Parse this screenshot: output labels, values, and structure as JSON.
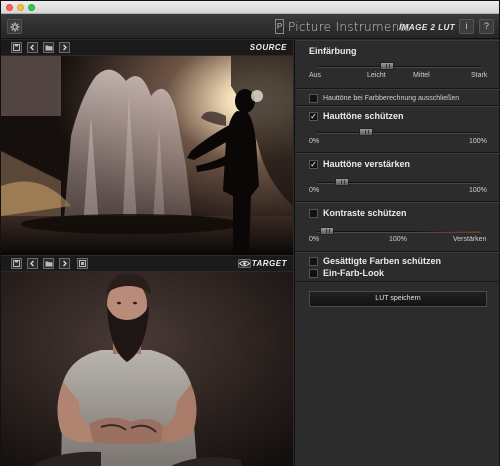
{
  "app": {
    "title": "Picture Instruments",
    "separator": "-",
    "subtitle": "IMAGE 2 LUT",
    "logo_glyph": "P",
    "info_label": "i",
    "help_label": "?"
  },
  "source": {
    "label": "SOURCE"
  },
  "target": {
    "label": "TARGET"
  },
  "panel": {
    "einfaerbung": {
      "title": "Einfärbung",
      "labels": [
        "Aus",
        "Leicht",
        "Mittel",
        "Stark"
      ],
      "value_fraction": 0.42
    },
    "hauttoene_ausschliessen": {
      "label": "Hauttöne bei Farbberechnung ausschließen",
      "checked": false
    },
    "hauttoene_schuetzen": {
      "label": "Hauttöne schützen",
      "checked": true,
      "min_label": "0%",
      "max_label": "100%",
      "value_fraction": 0.28
    },
    "hauttoene_verstaerken": {
      "label": "Hauttöne verstärken",
      "checked": true,
      "min_label": "0%",
      "max_label": "100%",
      "value_fraction": 0.12
    },
    "kontraste_schuetzen": {
      "label": "Kontraste schützen",
      "checked": false,
      "min_label": "0%",
      "mid_label": "100%",
      "max_label": "Verstärken",
      "value_fraction": 0.02
    },
    "gesaettigte_farben": {
      "label": "Gesättigte Farben schützen",
      "checked": false
    },
    "ein_farb_look": {
      "label": "Ein-Farb-Look",
      "checked": false
    },
    "save_button": "LUT speichern"
  },
  "colors": {
    "accent_track_red": "#7a2a1a",
    "panel_bg": "#2c2c2c"
  }
}
